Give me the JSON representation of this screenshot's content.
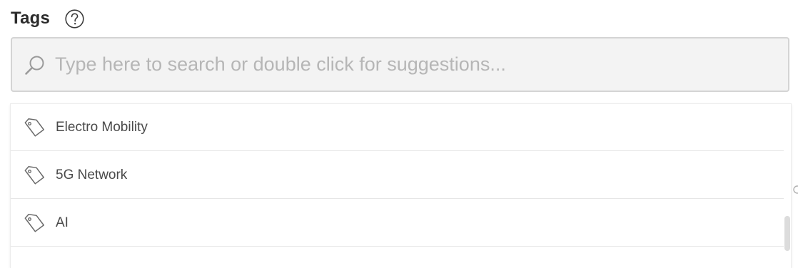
{
  "tags_panel": {
    "title": "Tags",
    "help_icon": "question-circle-icon"
  },
  "search": {
    "icon": "search-icon",
    "placeholder": "Type here to search or double click for suggestions...",
    "value": ""
  },
  "suggestions": {
    "items": [
      {
        "label": "Electro Mobility",
        "icon": "tag-icon"
      },
      {
        "label": "5G Network",
        "icon": "tag-icon"
      },
      {
        "label": "AI",
        "icon": "tag-icon"
      }
    ]
  },
  "colors": {
    "title_text": "#2b2b2b",
    "input_background": "#f3f3f3",
    "input_border": "#d4d4d4",
    "placeholder_text": "#b6b6b6",
    "option_text": "#4a4a4a",
    "divider": "#e6e6e6"
  }
}
